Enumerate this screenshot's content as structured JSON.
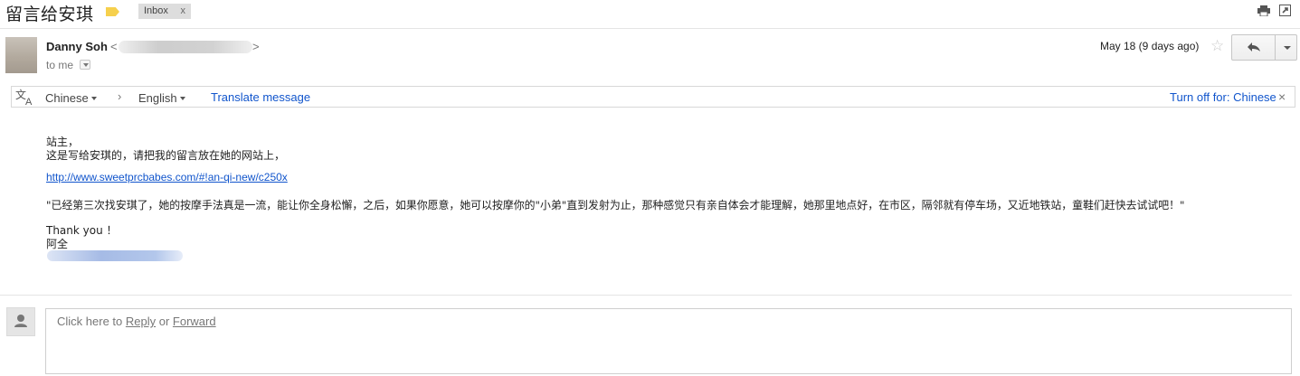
{
  "subject": {
    "title": "留言给安琪",
    "label_chip": "Inbox",
    "label_chip_close": "x"
  },
  "sender": {
    "name": "Danny Soh",
    "email_open": "<",
    "email_close": ">",
    "recipient": "to me",
    "date": "May 18 (9 days ago)"
  },
  "translate_bar": {
    "from_language": "Chinese",
    "arrow": "›",
    "to_language": "English",
    "translate_link": "Translate message",
    "turn_off_link": "Turn off for: Chinese",
    "close": "×"
  },
  "message": {
    "greeting": "站主，",
    "line1": "这是写给安琪的，请把我的留言放在她的网站上，",
    "link": "http://www.sweetprcbabes.com/#!an-qi-new/c250x",
    "paragraph": "\"已经第三次找安琪了，她的按摩手法真是一流，能让你全身松懈，之后，如果你愿意，她可以按摩你的\"小弟\"直到发射为止，那种感觉只有亲自体会才能理解，她那里地点好，在市区，隔邻就有停车场，又近地铁站，童鞋们赶快去试试吧！\"",
    "thanks": "Thank you ！",
    "signature": "阿全"
  },
  "reply": {
    "prefix": "Click here to ",
    "reply_link": "Reply",
    "or": " or ",
    "forward_link": "Forward"
  },
  "colors": {
    "link": "#1155cc",
    "label_tag": "#f6d04d"
  },
  "icons": [
    "label-tag-icon",
    "print-icon",
    "new-window-icon",
    "star-icon",
    "reply-icon",
    "translate-icon",
    "person-icon"
  ]
}
